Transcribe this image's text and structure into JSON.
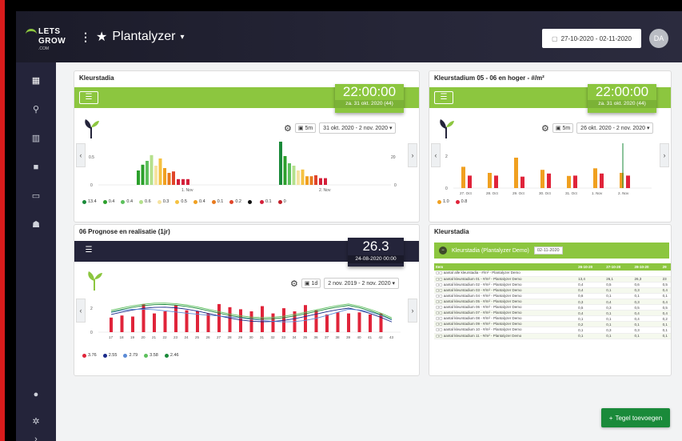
{
  "logo": {
    "line1": "LETS",
    "line2": "GROW",
    "line3": ".COM"
  },
  "app": {
    "title": "Plantalyzer",
    "menu_icon": "kebab-icon",
    "star_icon": "star-icon",
    "caret": "▾"
  },
  "header": {
    "date_range": "27-10-2020 - 02-11-2020",
    "avatar": "DA"
  },
  "sidebar": {
    "icons": [
      "dashboard-icon",
      "network-icon",
      "building-icon",
      "folder-icon",
      "image-icon",
      "users-icon"
    ],
    "bottom_icons": [
      "help-icon",
      "settings-icon",
      "expand-icon"
    ]
  },
  "card1": {
    "title": "Kleurstadia",
    "clock": {
      "time": "22:00:00",
      "date": "za. 31 okt. 2020 (44)"
    },
    "toolbar": {
      "interval": "5m",
      "range": "31 okt. 2020 - 2 nov. 2020"
    },
    "chart_data": {
      "type": "bar",
      "x_ticks": [
        "1. Nov",
        "2. Nov"
      ],
      "y_left_ticks": [
        "0",
        "0.5"
      ],
      "y_right_ticks": [
        "0",
        "20"
      ],
      "legend": [
        {
          "label": "13.4",
          "color": "#1a8a3a"
        },
        {
          "label": "0.4",
          "color": "#2ca02c"
        },
        {
          "label": "0.4",
          "color": "#5cc05c"
        },
        {
          "label": "0.6",
          "color": "#b4e08c"
        },
        {
          "label": "0.3",
          "color": "#f5e3a0"
        },
        {
          "label": "0.5",
          "color": "#f5c242"
        },
        {
          "label": "0.4",
          "color": "#f0a020"
        },
        {
          "label": "0.1",
          "color": "#e87a1e"
        },
        {
          "label": "0.2",
          "color": "#e0452a"
        },
        {
          "label": "",
          "color": "#111111"
        },
        {
          "label": "0.1",
          "color": "#d4203a"
        },
        {
          "label": "0",
          "color": "#c0202a"
        }
      ]
    }
  },
  "card2": {
    "title": "Kleurstadium 05 - 06 en hoger - #/m²",
    "clock": {
      "time": "22:00:00",
      "date": "za. 31 okt. 2020 (44)"
    },
    "toolbar": {
      "interval": "5m",
      "range": "26 okt. 2020 - 2 nov. 2020"
    },
    "chart_data": {
      "type": "bar",
      "categories": [
        "27. Oct",
        "28. Oct",
        "29. Oct",
        "30. Oct",
        "31. Oct",
        "1. Nov",
        "2. Nov"
      ],
      "y_ticks": [
        "0",
        "2"
      ],
      "legend": [
        {
          "label": "1.0",
          "color": "#f0a020"
        },
        {
          "label": "0.8",
          "color": "#e0243a"
        }
      ]
    }
  },
  "card3": {
    "title": "06 Prognose en realisatie (1jr)",
    "clock": {
      "time": "26.3",
      "date": "24-08-2020 00:00"
    },
    "toolbar": {
      "interval": "1d",
      "range": "2 nov. 2019 - 2 nov. 2020"
    },
    "chart_data": {
      "type": "bar",
      "categories": [
        "17",
        "18",
        "19",
        "20",
        "21",
        "22",
        "23",
        "24",
        "25",
        "26",
        "27",
        "28",
        "29",
        "30",
        "31",
        "32",
        "33",
        "34",
        "35",
        "36",
        "37",
        "38",
        "39",
        "40",
        "41",
        "42",
        "43"
      ],
      "y_ticks": [
        "0",
        "2"
      ],
      "legend": [
        {
          "label": "3.76",
          "color": "#e0243a"
        },
        {
          "label": "2.55",
          "color": "#1a2a8a"
        },
        {
          "label": "2.79",
          "color": "#5b8bd6"
        },
        {
          "label": "3.58",
          "color": "#5cc05c"
        },
        {
          "label": "2.46",
          "color": "#1a8a3a"
        }
      ]
    }
  },
  "card4": {
    "title": "Kleurstadia",
    "subheader": "Kleurstadia (Plantalyzer Demo)",
    "date_input": "02-11-2020",
    "columns": [
      "Item",
      "26-10-20",
      "27-10-20",
      "28-10-20",
      "29"
    ],
    "rows": [
      [
        "aantal alle kleurstadia - #/m² - Plantalyzer Demo",
        "",
        "",
        "",
        ""
      ],
      [
        "aantal kleurstadium 01 - #/m² - Plantalyzer Demo",
        "13,4",
        "26,1",
        "26,3",
        "23"
      ],
      [
        "aantal kleurstadium 02 - #/m² - Plantalyzer Demo",
        "0,4",
        "0,5",
        "0,6",
        "0,5"
      ],
      [
        "aantal kleurstadium 03 - #/m² - Plantalyzer Demo",
        "0,4",
        "0,1",
        "0,3",
        "0,4"
      ],
      [
        "aantal kleurstadium 04 - #/m² - Plantalyzer Demo",
        "0,6",
        "0,1",
        "0,1",
        "0,1"
      ],
      [
        "aantal kleurstadium 05 - #/m² - Plantalyzer Demo",
        "0,3",
        "0,4",
        "0,3",
        "0,4"
      ],
      [
        "aantal kleurstadium 06 - #/m² - Plantalyzer Demo",
        "0,5",
        "0,3",
        "0,5",
        "0,5"
      ],
      [
        "aantal kleurstadium 07 - #/m² - Plantalyzer Demo",
        "0,4",
        "0,1",
        "0,4",
        "0,4"
      ],
      [
        "aantal kleurstadium 08 - #/m² - Plantalyzer Demo",
        "0,1",
        "0,1",
        "0,4",
        "0,2"
      ],
      [
        "aantal kleurstadium 09 - #/m² - Plantalyzer Demo",
        "0,2",
        "0,1",
        "0,1",
        "0,1"
      ],
      [
        "aantal kleurstadium 10 - #/m² - Plantalyzer Demo",
        "0,1",
        "0,3",
        "0,3",
        "0,1"
      ],
      [
        "aantal kleurstadium 11 - #/m² - Plantalyzer Demo",
        "0,1",
        "0,1",
        "0,1",
        "0,1"
      ]
    ]
  },
  "add_button": {
    "label": "Tegel toevoegen",
    "icon": "+"
  },
  "colors": {
    "green": "#8cc63f",
    "dark": "#24243a",
    "add": "#1a8a3a"
  }
}
